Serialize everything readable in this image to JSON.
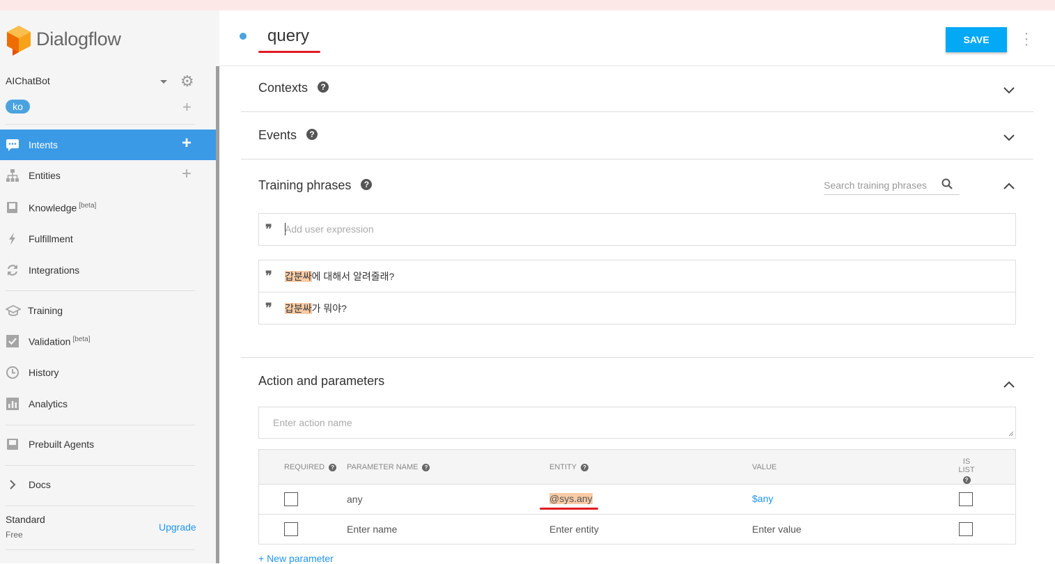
{
  "app": {
    "name": "Dialogflow"
  },
  "agent": {
    "name": "AIChatBot",
    "language": "ko"
  },
  "nav": {
    "intents": "Intents",
    "entities": "Entities",
    "knowledge": "Knowledge",
    "knowledge_badge": "[beta]",
    "fulfillment": "Fulfillment",
    "integrations": "Integrations",
    "training": "Training",
    "validation": "Validation",
    "validation_badge": "[beta]",
    "history": "History",
    "analytics": "Analytics",
    "prebuilt": "Prebuilt Agents",
    "docs": "Docs"
  },
  "plan": {
    "name": "Standard",
    "tier": "Free",
    "upgrade": "Upgrade"
  },
  "intent": {
    "name": "query",
    "save_label": "SAVE"
  },
  "sections": {
    "contexts": "Contexts",
    "events": "Events",
    "training": "Training phrases",
    "action": "Action and parameters"
  },
  "training": {
    "search_placeholder": "Search training phrases",
    "add_placeholder": "Add user expression",
    "phrases": [
      {
        "highlight": "갑분싸",
        "rest": "에 대해서 알려줄래?"
      },
      {
        "highlight": "갑분싸",
        "rest": "가 뭐야?"
      }
    ]
  },
  "action": {
    "placeholder": "Enter action name"
  },
  "params": {
    "headers": {
      "required": "REQUIRED",
      "name": "PARAMETER NAME",
      "entity": "ENTITY",
      "value": "VALUE",
      "is_list": "IS LIST"
    },
    "rows": [
      {
        "name": "any",
        "entity": "@sys.any",
        "value": "$any"
      }
    ],
    "placeholder_row": {
      "name": "Enter name",
      "entity": "Enter entity",
      "value": "Enter value"
    },
    "new_parameter": "+ New parameter"
  },
  "colors": {
    "accent": "#3a9ae6",
    "save": "#03a9f4",
    "highlight": "#f8cba6",
    "annotation": "#e01b24"
  }
}
